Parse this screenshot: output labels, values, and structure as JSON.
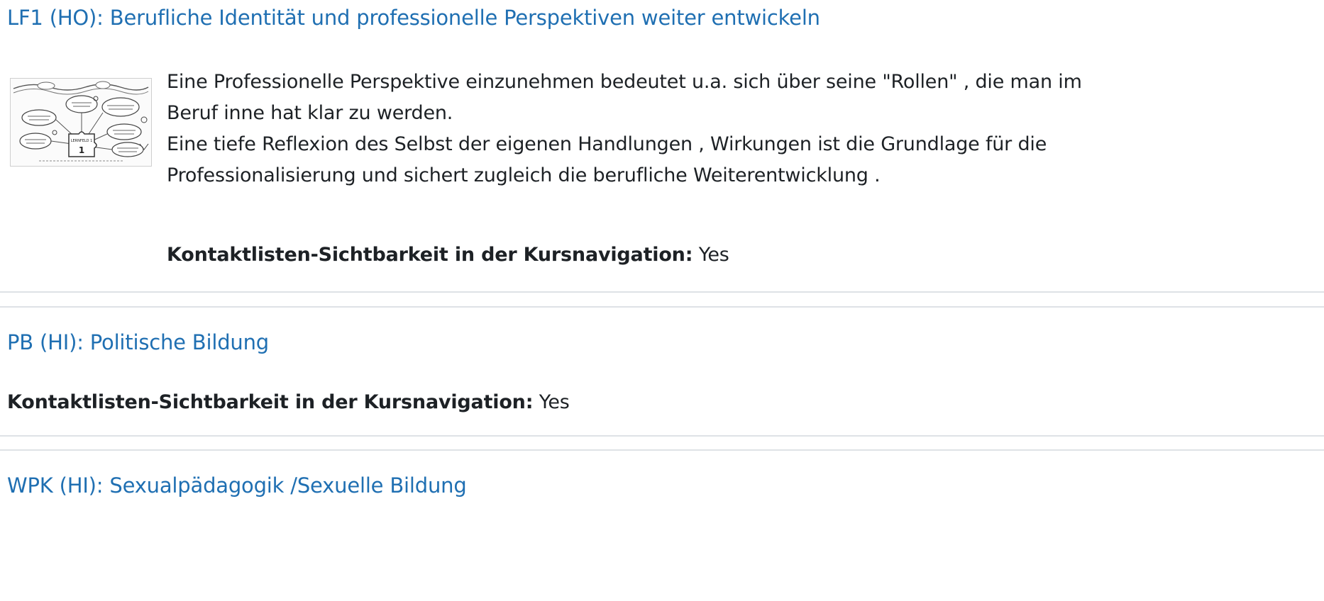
{
  "courses": [
    {
      "title": "LF1 (HO): Berufliche Identität und professionelle Perspektiven weiter entwickeln",
      "summary_lines": [
        "Eine Professionelle Perspektive einzunehmen bedeutet u.a.  sich über seine \"Rollen\" , die man im",
        "Beruf inne hat klar zu werden.",
        "Eine tiefe Reflexion des Selbst der eigenen Handlungen , Wirkungen ist die Grundlage für die",
        "Professionalisierung und sichert zugleich die berufliche Weiterentwicklung ."
      ],
      "contact_label": "Kontaktlisten-Sichtbarkeit in der Kursnavigation:",
      "contact_value": "Yes",
      "image_label": "LERNFELD 1"
    },
    {
      "title": "PB (HI): Politische Bildung",
      "contact_label": "Kontaktlisten-Sichtbarkeit in der Kursnavigation:",
      "contact_value": "Yes"
    },
    {
      "title": "WPK (HI): Sexualpädagogik /Sexuelle Bildung"
    }
  ],
  "colors": {
    "link": "#1f6fb2",
    "text": "#1d2125",
    "divider": "#dee2e6"
  }
}
